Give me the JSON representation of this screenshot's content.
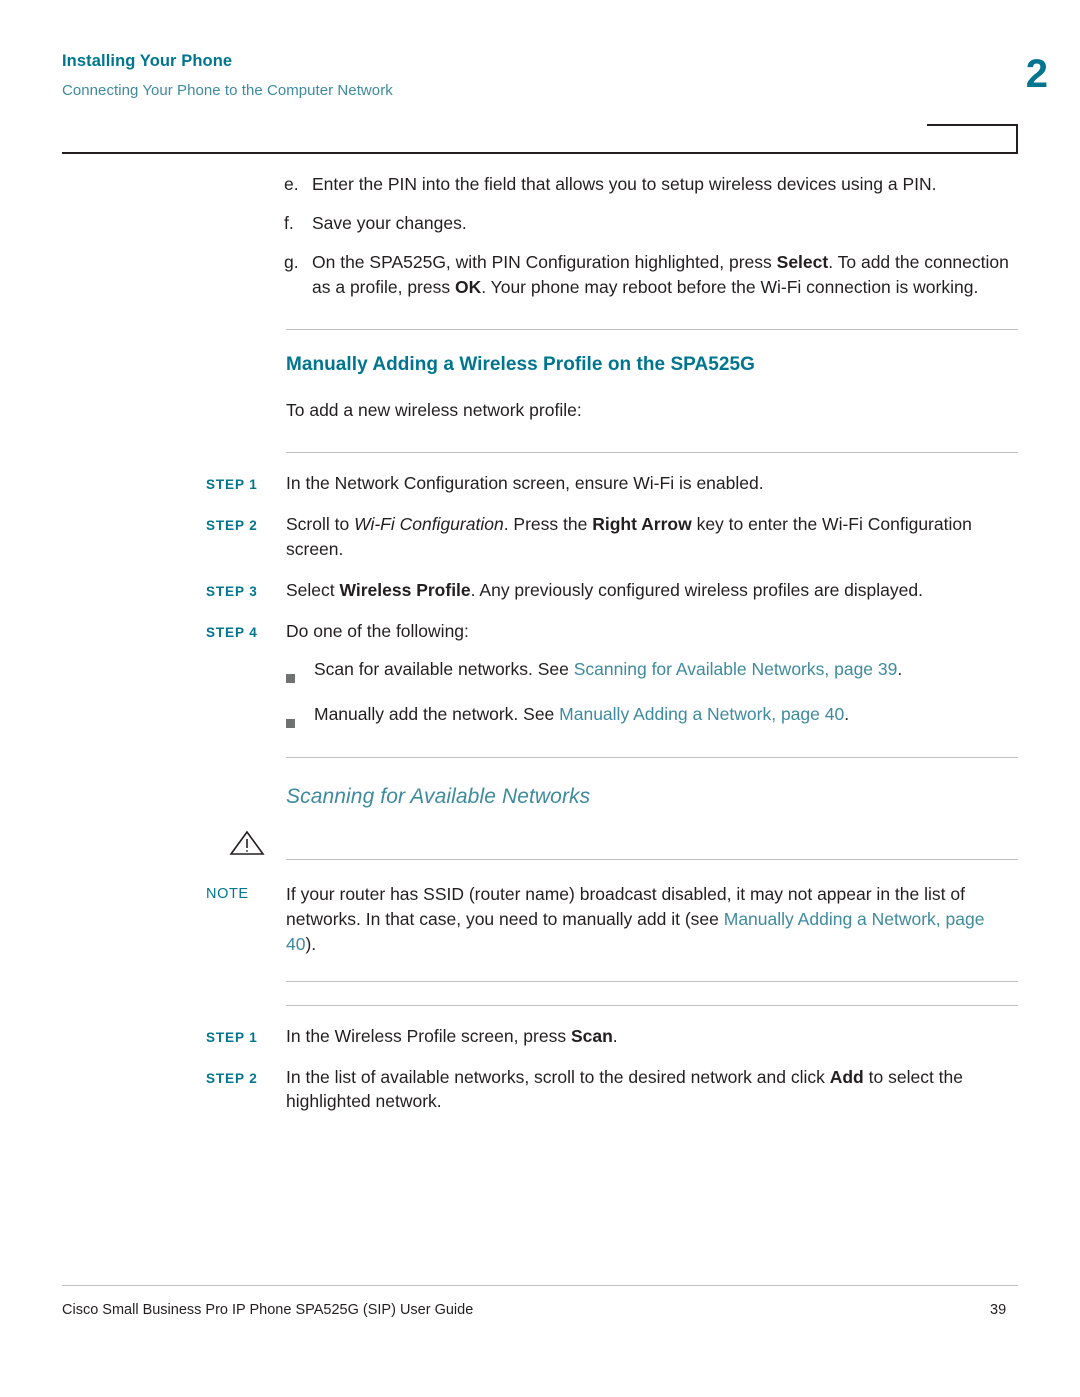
{
  "header": {
    "title": "Installing Your Phone",
    "subtitle": "Connecting Your Phone to the Computer Network",
    "chapter_number": "2"
  },
  "alpha_steps": [
    {
      "marker": "e.",
      "text_parts": [
        {
          "t": "Enter the PIN into the field that allows you to setup wireless devices using a PIN.",
          "style": "normal"
        }
      ]
    },
    {
      "marker": "f.",
      "text_parts": [
        {
          "t": "Save your changes.",
          "style": "normal"
        }
      ]
    },
    {
      "marker": "g.",
      "text_parts": [
        {
          "t": "On the SPA525G, with PIN Configuration highlighted, press ",
          "style": "normal"
        },
        {
          "t": "Select",
          "style": "bold"
        },
        {
          "t": ". To add the connection as a profile, press ",
          "style": "normal"
        },
        {
          "t": "OK",
          "style": "bold"
        },
        {
          "t": ". Your phone may reboot before the Wi-Fi connection is working.",
          "style": "normal"
        }
      ]
    }
  ],
  "section": {
    "title": "Manually Adding a Wireless Profile on the SPA525G",
    "intro": "To add a new wireless network profile:"
  },
  "steps_a": [
    {
      "label": "STEP 1",
      "parts": [
        {
          "t": "In the Network Configuration screen, ensure Wi-Fi is enabled.",
          "style": "normal"
        }
      ]
    },
    {
      "label": "STEP 2",
      "parts": [
        {
          "t": "Scroll to ",
          "style": "normal"
        },
        {
          "t": "Wi-Fi Configuration",
          "style": "italic"
        },
        {
          "t": ". Press the ",
          "style": "normal"
        },
        {
          "t": "Right Arrow",
          "style": "bold"
        },
        {
          "t": " key to enter the Wi-Fi Configuration screen.",
          "style": "normal"
        }
      ]
    },
    {
      "label": "STEP 3",
      "parts": [
        {
          "t": "Select ",
          "style": "normal"
        },
        {
          "t": "Wireless Profile",
          "style": "bold"
        },
        {
          "t": ". Any previously configured wireless profiles are displayed.",
          "style": "normal"
        }
      ]
    },
    {
      "label": "STEP 4",
      "parts": [
        {
          "t": "Do one of the following:",
          "style": "normal"
        }
      ]
    }
  ],
  "bullets": [
    {
      "parts": [
        {
          "t": "Scan for available networks. See ",
          "style": "normal"
        },
        {
          "t": "Scanning for Available Networks, page 39",
          "style": "link"
        },
        {
          "t": ".",
          "style": "normal"
        }
      ]
    },
    {
      "parts": [
        {
          "t": "Manually add the network. See ",
          "style": "normal"
        },
        {
          "t": "Manually Adding a Network, page 40",
          "style": "link"
        },
        {
          "t": ".",
          "style": "normal"
        }
      ]
    }
  ],
  "subsection": {
    "title": "Scanning for Available Networks"
  },
  "note": {
    "label": "NOTE",
    "parts": [
      {
        "t": "If your router has SSID (router name) broadcast disabled, it may not appear in the list of networks. In that case, you need to manually add it (see ",
        "style": "normal"
      },
      {
        "t": "Manually Adding a Network, page 40",
        "style": "link"
      },
      {
        "t": ").",
        "style": "normal"
      }
    ]
  },
  "steps_b": [
    {
      "label": "STEP 1",
      "parts": [
        {
          "t": "In the Wireless Profile screen, press ",
          "style": "normal"
        },
        {
          "t": "Scan",
          "style": "bold"
        },
        {
          "t": ".",
          "style": "normal"
        }
      ]
    },
    {
      "label": "STEP 2",
      "parts": [
        {
          "t": "In the list of available networks, scroll to the desired network and click ",
          "style": "normal"
        },
        {
          "t": "Add",
          "style": "bold"
        },
        {
          "t": " to select the highlighted network.",
          "style": "normal"
        }
      ]
    }
  ],
  "footer": {
    "left": "Cisco Small Business Pro IP Phone SPA525G (SIP) User Guide",
    "page_number": "39"
  },
  "colors": {
    "heading_teal": "#00758f",
    "link_teal": "#3e8a9e",
    "text": "#231f20",
    "rule": "#bfbfbf"
  }
}
